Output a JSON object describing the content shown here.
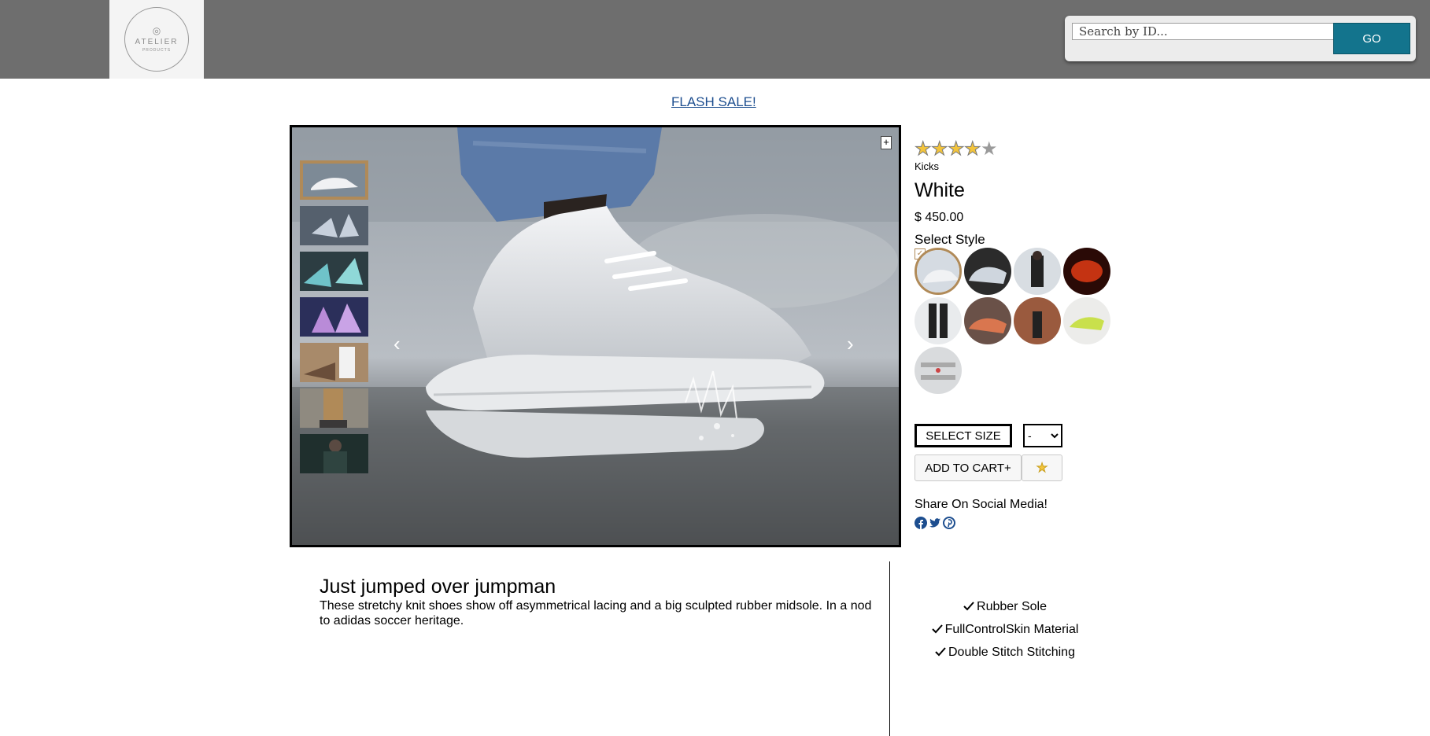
{
  "header": {
    "logo": {
      "name": "ATELIER",
      "tagline": "PRODUCTS"
    },
    "search": {
      "placeholder": "Search by ID...",
      "button_label": "GO"
    }
  },
  "banner": {
    "text": "FLASH SALE!"
  },
  "gallery": {
    "thumbnails_count": 7,
    "selected_thumbnail": 1,
    "prev_label": "‹",
    "next_label": "›",
    "expand_label": "+"
  },
  "product": {
    "rating": 4,
    "rating_max": 5,
    "category": "Kicks",
    "name": "White",
    "price": "$ 450.00",
    "style_label": "Select Style",
    "styles_count": 9,
    "selected_style": 1,
    "size_label": "SELECT SIZE",
    "quantity_value": "-",
    "cart_label": "ADD TO CART+",
    "favorite_icon": "star-icon",
    "share_label": "Share On Social Media!",
    "social": [
      "facebook-icon",
      "twitter-icon",
      "pinterest-icon"
    ]
  },
  "overview": {
    "slogan": "Just jumped over jumpman",
    "description": "These stretchy knit shoes show off asymmetrical lacing and a big sculpted rubber midsole. In a nod to adidas soccer heritage.",
    "features": [
      "Rubber Sole",
      "FullControlSkin Material",
      "Double Stitch Stitching"
    ]
  },
  "colors": {
    "header_bg": "#6e6e6e",
    "accent": "#13748d",
    "selected_border": "#b08a58",
    "link": "#1d4e8f",
    "star_fill": "#f3c43c"
  }
}
